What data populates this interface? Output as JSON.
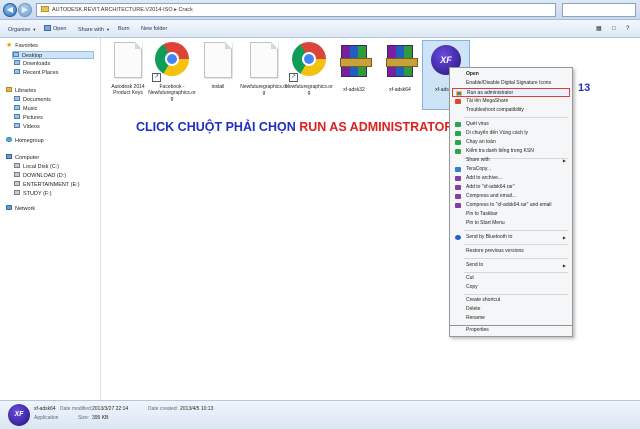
{
  "address": {
    "path": "AUTODESK.REVIT.ARCHITECTURE.V2014-ISO  ▸  Crack"
  },
  "toolbar": {
    "organize": "Organize",
    "open": "Open",
    "share_with": "Share with",
    "burn": "Burn",
    "new_folder": "New folder"
  },
  "nav": {
    "favorites": "Favorites",
    "desktop": "Desktop",
    "downloads": "Downloads",
    "recent": "Recent Places",
    "libraries": "Libraries",
    "documents": "Documents",
    "music": "Music",
    "pictures": "Pictures",
    "videos": "Videos",
    "homegroup": "Homegroup",
    "computer": "Computer",
    "local_disk": "Local Disk (C:)",
    "download_d": "DOWNLOAD (D:)",
    "entertainment": "ENTERTAINMENT (E:)",
    "study": "STUDY (F:)",
    "network": "Network"
  },
  "files": [
    {
      "label": "Autodesk 2014 Product Keys",
      "icon": "document-icon"
    },
    {
      "label": "Facebook - Newfuturegraphics.org",
      "icon": "chrome-icon"
    },
    {
      "label": "install",
      "icon": "document-icon"
    },
    {
      "label": "Newfuturegraphics.org",
      "icon": "document-icon"
    },
    {
      "label": "Newfuturegraphics.org",
      "icon": "chrome-icon"
    },
    {
      "label": "xf-adsk32",
      "icon": "winrar-icon"
    },
    {
      "label": "xf-adsk64",
      "icon": "winrar-icon"
    },
    {
      "label": "xf-adsk64",
      "icon": "xf-keygen-icon"
    }
  ],
  "instruction": {
    "prefix": "CLICK CHUỘT PHẢI CHỌN ",
    "highlight": "RUN AS ADMINISTRATOR"
  },
  "step_number": "13",
  "context_menu": {
    "items": [
      "Open",
      "Enable/Disable Digital Signature Icons",
      "Run as administrator",
      "Tải lên MegaShare",
      "Troubleshoot compatibility",
      "Quét virus",
      "Di chuyển đến Vùng cách ly",
      "Chạy an toàn",
      "Kiểm tra danh tiếng trong KSN",
      "Share with",
      "TeraCopy...",
      "Add to archive...",
      "Add to \"xf-adsk64.rar\"",
      "Compress and email...",
      "Compress to \"xf-adsk64.rar\" and email",
      "Pin to Taskbar",
      "Pin to Start Menu",
      "Send by Bluetooth to",
      "Restore previous versions",
      "Send to",
      "Cut",
      "Copy",
      "Create shortcut",
      "Delete",
      "Rename",
      "Properties"
    ]
  },
  "details": {
    "name": "xf-adsk64",
    "type": "Application",
    "modified_label": "Date modified:",
    "modified": "2013/3/27 22:14",
    "size_label": "Size:",
    "size": "395 KB",
    "created_label": "Date created:",
    "created": "2013/4/5 10:13"
  },
  "colors": {
    "instruction_blue": "#1f2fbf",
    "instruction_red": "#e02020",
    "highlight_border": "#e23b3b"
  }
}
